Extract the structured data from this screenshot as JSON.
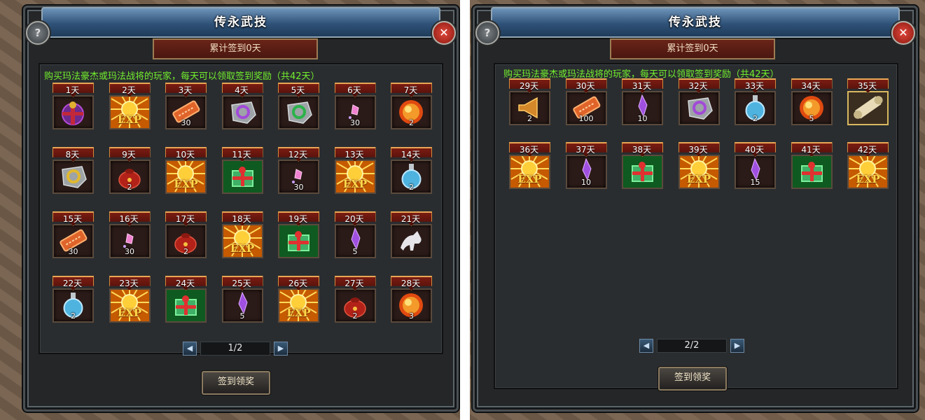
{
  "panels": [
    {
      "title": "传永武技",
      "checkin_label": "累计签到0天",
      "notice": "购买玛法豪杰或玛法战将的玩家，每天可以领取签到奖励（共42天）",
      "page_indicator": "1/2",
      "claim_label": "签到领奖",
      "help_icon": "?",
      "close_icon": "✕",
      "days": [
        {
          "label": "1天",
          "icon": "gift-bag-icon",
          "count": ""
        },
        {
          "label": "2天",
          "icon": "exp-orb-icon",
          "count": "EXP"
        },
        {
          "label": "3天",
          "icon": "scroll-ticket-icon",
          "count": "30"
        },
        {
          "label": "4天",
          "icon": "purple-rune-stone-icon",
          "count": ""
        },
        {
          "label": "5天",
          "icon": "green-rune-stone-icon",
          "count": ""
        },
        {
          "label": "6天",
          "icon": "pink-gem-icon",
          "count": "30"
        },
        {
          "label": "7天",
          "icon": "fire-orb-icon",
          "count": "2"
        },
        {
          "label": "8天",
          "icon": "gold-rune-stone-icon",
          "count": ""
        },
        {
          "label": "9天",
          "icon": "red-pouch-icon",
          "count": "2"
        },
        {
          "label": "10天",
          "icon": "exp-orb-icon",
          "count": "EXP"
        },
        {
          "label": "11天",
          "icon": "green-gift-box-icon",
          "count": ""
        },
        {
          "label": "12天",
          "icon": "pink-gem-icon",
          "count": "30"
        },
        {
          "label": "13天",
          "icon": "exp-orb-icon",
          "count": "EXP"
        },
        {
          "label": "14天",
          "icon": "blue-potion-icon",
          "count": "2"
        },
        {
          "label": "15天",
          "icon": "scroll-ticket-icon",
          "count": "30"
        },
        {
          "label": "16天",
          "icon": "pink-gem-icon",
          "count": "30"
        },
        {
          "label": "17天",
          "icon": "red-pouch-icon",
          "count": "2"
        },
        {
          "label": "18天",
          "icon": "exp-orb-icon",
          "count": "EXP"
        },
        {
          "label": "19天",
          "icon": "green-gift-box-icon",
          "count": ""
        },
        {
          "label": "20天",
          "icon": "purple-crystal-icon",
          "count": "5"
        },
        {
          "label": "21天",
          "icon": "white-horse-icon",
          "count": ""
        },
        {
          "label": "22天",
          "icon": "blue-potion-icon",
          "count": "2"
        },
        {
          "label": "23天",
          "icon": "exp-orb-icon",
          "count": "EXP"
        },
        {
          "label": "24天",
          "icon": "green-gift-box-icon",
          "count": ""
        },
        {
          "label": "25天",
          "icon": "purple-crystal-icon",
          "count": "5"
        },
        {
          "label": "26天",
          "icon": "exp-orb-icon",
          "count": "EXP"
        },
        {
          "label": "27天",
          "icon": "red-pouch-icon",
          "count": "2"
        },
        {
          "label": "28天",
          "icon": "fire-orb-icon",
          "count": "3"
        }
      ]
    },
    {
      "title": "传永武技",
      "checkin_label": "累计签到0天",
      "notice": "购买玛法豪杰或玛法战将的玩家，每天可以领取签到奖励（共42天）",
      "page_indicator": "2/2",
      "claim_label": "签到领奖",
      "help_icon": "?",
      "close_icon": "✕",
      "days": [
        {
          "label": "29天",
          "icon": "horn-icon",
          "count": "2"
        },
        {
          "label": "30天",
          "icon": "scroll-ticket-icon",
          "count": "100"
        },
        {
          "label": "31天",
          "icon": "purple-crystal-icon",
          "count": "10"
        },
        {
          "label": "32天",
          "icon": "purple-rune-stone-icon",
          "count": ""
        },
        {
          "label": "33天",
          "icon": "blue-potion-icon",
          "count": "2"
        },
        {
          "label": "34天",
          "icon": "fire-orb-icon",
          "count": "5"
        },
        {
          "label": "35天",
          "icon": "parchment-scroll-icon",
          "count": ""
        },
        {
          "label": "36天",
          "icon": "exp-orb-icon",
          "count": "EXP"
        },
        {
          "label": "37天",
          "icon": "purple-crystal-icon",
          "count": "10"
        },
        {
          "label": "38天",
          "icon": "green-gift-box-icon",
          "count": ""
        },
        {
          "label": "39天",
          "icon": "exp-orb-icon",
          "count": "EXP"
        },
        {
          "label": "40天",
          "icon": "purple-crystal-icon",
          "count": "15"
        },
        {
          "label": "41天",
          "icon": "green-gift-box-icon",
          "count": ""
        },
        {
          "label": "42天",
          "icon": "exp-orb-icon",
          "count": "EXP"
        }
      ]
    }
  ]
}
